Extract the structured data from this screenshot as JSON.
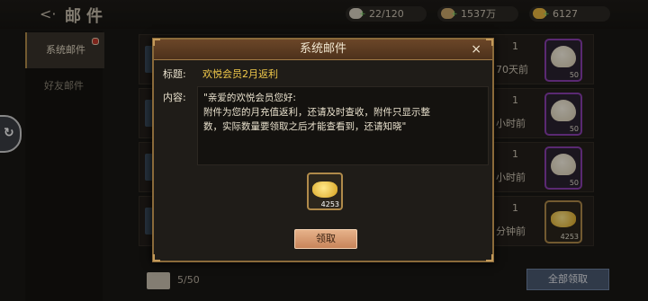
{
  "header": {
    "back_icon": "back-arrow-icon",
    "title": "邮件"
  },
  "resources": [
    {
      "icon": "coin-stack-icon",
      "value": "22/120",
      "color": "#d8d0c0"
    },
    {
      "icon": "copper-coin-icon",
      "value": "1537万",
      "color": "#c9a76a"
    },
    {
      "icon": "gold-ingot-icon",
      "value": "6127",
      "color": "#e8b640"
    }
  ],
  "sidebar": {
    "items": [
      {
        "label": "系统邮件",
        "badge": true
      },
      {
        "label": "好友邮件",
        "badge": false
      }
    ]
  },
  "mail_list": [
    {
      "count": "1",
      "time": "70天前",
      "item_icon": "steamed-bun-icon",
      "item_qty": "50"
    },
    {
      "count": "1",
      "time": "小时前",
      "item_icon": "steamed-bun-icon",
      "item_qty": "50"
    },
    {
      "count": "1",
      "time": "小时前",
      "item_icon": "steamed-bun-icon",
      "item_qty": "50"
    },
    {
      "count": "1",
      "time": "分钟前",
      "item_icon": "gold-ingot-icon",
      "item_qty": "4253"
    }
  ],
  "footer": {
    "mail_count": "5/50",
    "claim_all_label": "全部领取"
  },
  "modal": {
    "title": "系统邮件",
    "close": "×",
    "subject_label": "标题:",
    "subject": "欢悦会员2月返利",
    "content_label": "内容:",
    "content": "\"亲爱的欢悦会员您好:附件为您的月充值返利，还请及时查收，附件只显示整数，实际数量要领取之后才能查看到，还请知晓\"",
    "content_lines": [
      "\"亲爱的欢悦会员您好:",
      "附件为您的月充值返利，还请及时查收，附件只显示整",
      "数，实际数量要领取之后才能查看到，还请知晓\""
    ],
    "reward": {
      "icon": "gold-ingot-icon",
      "qty": "4253"
    },
    "claim_label": "领取"
  }
}
